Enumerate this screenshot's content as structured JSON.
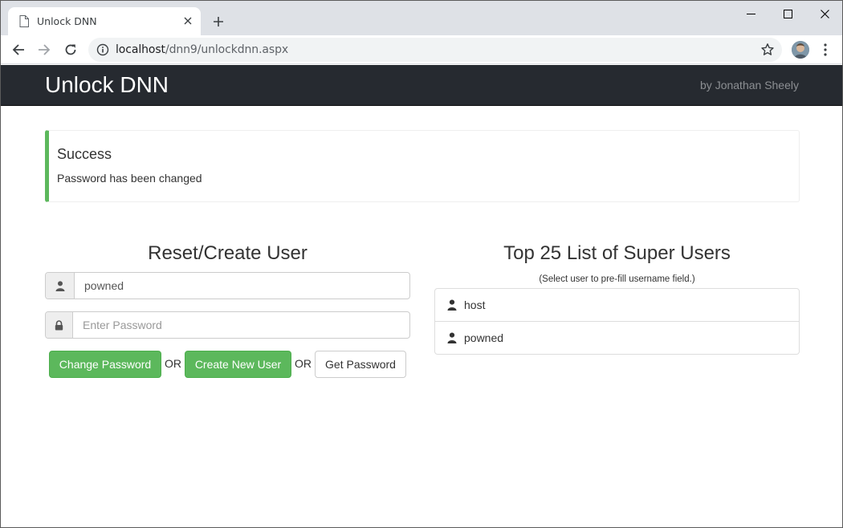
{
  "browser": {
    "tab_title": "Unlock DNN",
    "url_host": "localhost",
    "url_path": "/dnn9/unlockdnn.aspx"
  },
  "navbar": {
    "brand": "Unlock DNN",
    "byline": "by Jonathan Sheely"
  },
  "alert": {
    "title": "Success",
    "message": "Password has been changed",
    "accent_color": "#5cb85c"
  },
  "reset_form": {
    "title": "Reset/Create User",
    "username_value": "powned",
    "password_placeholder": "Enter Password",
    "change_password_label": "Change Password",
    "or_1": "OR",
    "create_user_label": "Create New User",
    "or_2": "OR",
    "get_password_label": "Get Password"
  },
  "super_users": {
    "title": "Top 25 List of Super Users",
    "subtitle": "(Select user to pre-fill username field.)",
    "users": [
      {
        "name": "host",
        "icon": "user-icon"
      },
      {
        "name": "powned",
        "icon": "user-icon"
      }
    ]
  },
  "colors": {
    "navbar_bg": "#262a30",
    "success": "#5cb85c"
  }
}
